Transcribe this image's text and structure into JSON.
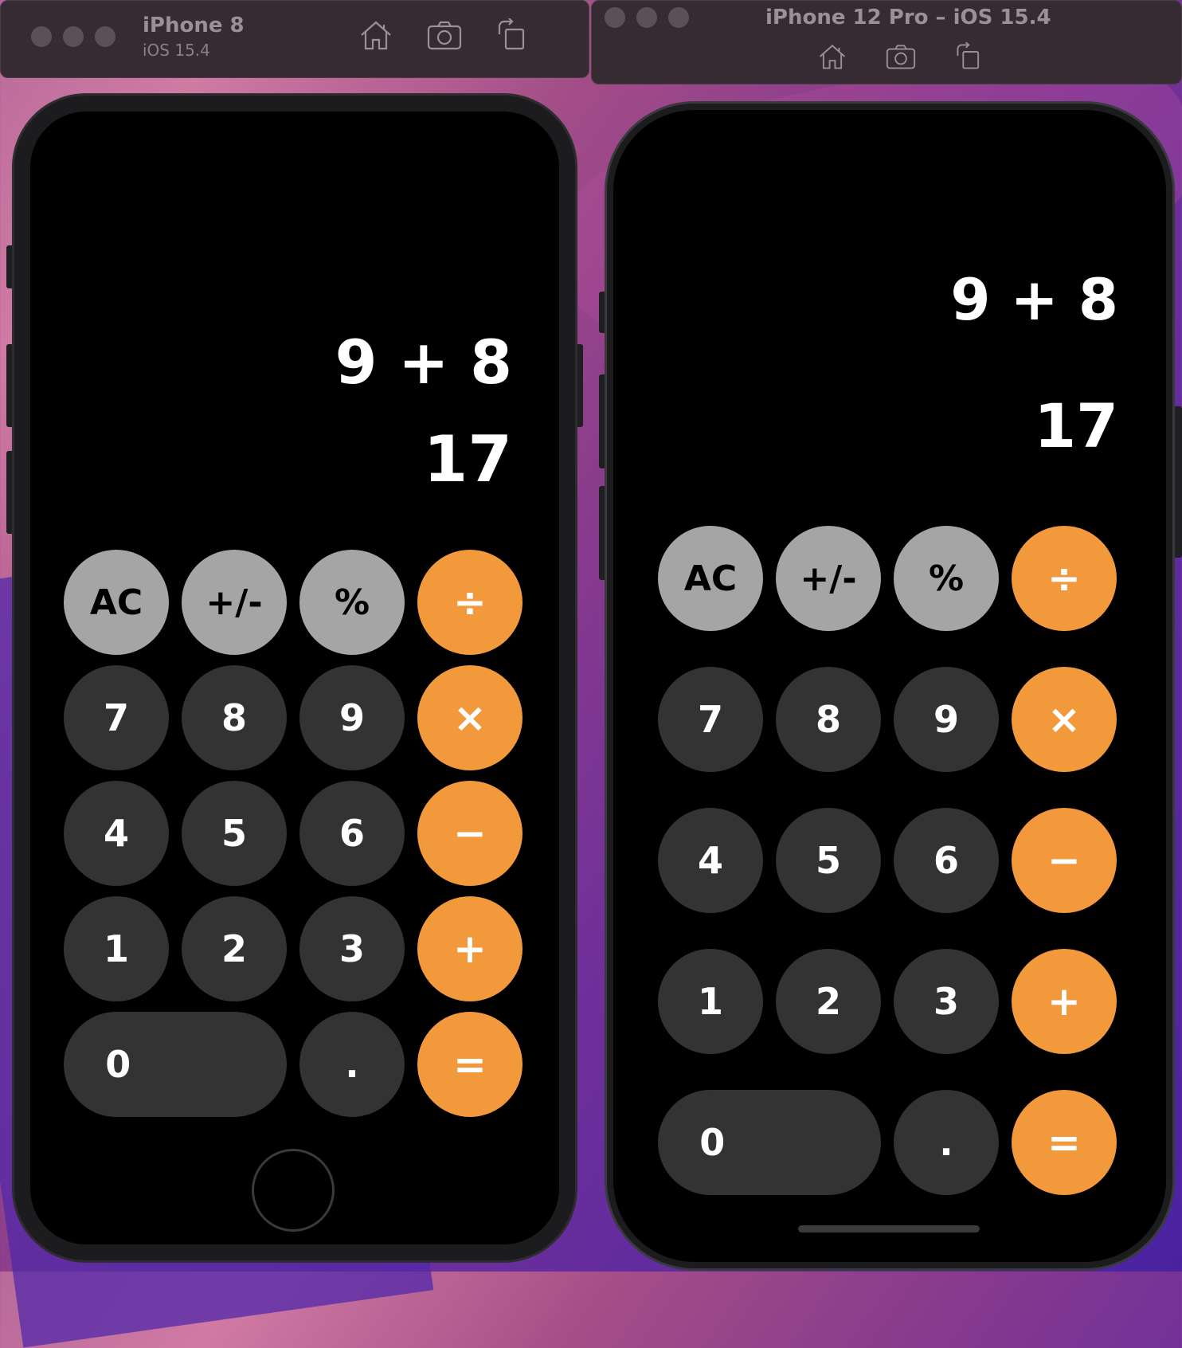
{
  "windows": [
    {
      "device_name": "iPhone 8",
      "os_version": "iOS 15.4",
      "display": {
        "expression": "9 + 8",
        "result": "17"
      }
    },
    {
      "device_name": "iPhone 12 Pro – iOS 15.4",
      "display": {
        "expression": "9 + 8",
        "result": "17"
      }
    }
  ],
  "toolbar_icons": [
    "home-icon",
    "screenshot-icon",
    "rotate-icon"
  ],
  "keypad": {
    "row1": [
      "AC",
      "+/-",
      "%",
      "÷"
    ],
    "row2": [
      "7",
      "8",
      "9",
      "×"
    ],
    "row3": [
      "4",
      "5",
      "6",
      "−"
    ],
    "row4": [
      "1",
      "2",
      "3",
      "+"
    ],
    "row5": [
      "0",
      ".",
      "="
    ]
  },
  "colors": {
    "function_key": "#a5a5a5",
    "digit_key": "#333333",
    "operator_key": "#f1993b",
    "screen": "#000000"
  }
}
